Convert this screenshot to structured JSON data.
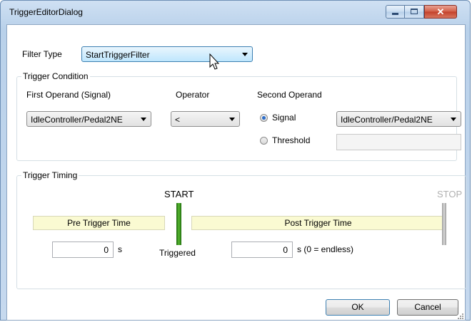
{
  "window": {
    "title": "TriggerEditorDialog"
  },
  "filter": {
    "label": "Filter Type",
    "value": "StartTriggerFilter"
  },
  "condition": {
    "group_label": "Trigger Condition",
    "first_operand_label": "First Operand (Signal)",
    "first_operand_value": "IdleController/Pedal2NE",
    "operator_label": "Operator",
    "operator_value": "<",
    "second_operand_label": "Second Operand",
    "signal_radio_label": "Signal",
    "signal_selected": true,
    "signal_value": "IdleController/Pedal2NE",
    "threshold_radio_label": "Threshold",
    "threshold_value": ""
  },
  "timing": {
    "group_label": "Trigger Timing",
    "start_label": "START",
    "stop_label": "STOP",
    "pre_label": "Pre Trigger Time",
    "post_label": "Post Trigger Time",
    "pre_value": "0",
    "pre_unit": "s",
    "post_value": "0",
    "post_unit": "s (0 = endless)",
    "triggered_label": "Triggered"
  },
  "buttons": {
    "ok": "OK",
    "cancel": "Cancel"
  },
  "colors": {
    "start_marker": "#3f9b1f",
    "stop_marker": "#b0b0b0",
    "time_band": "#fafad2"
  }
}
